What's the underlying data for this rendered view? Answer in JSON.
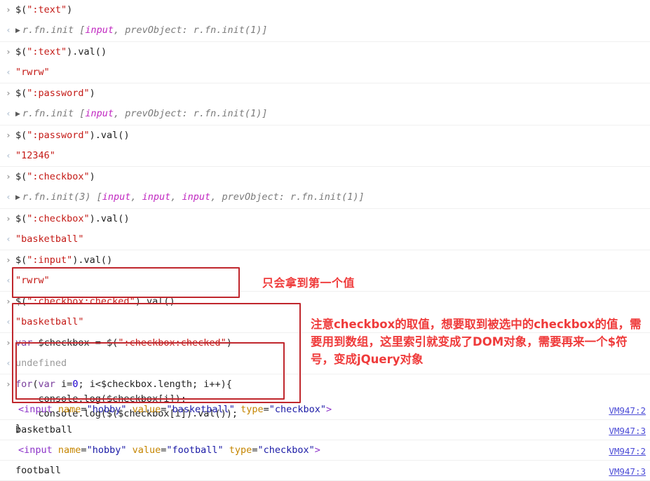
{
  "app": {
    "name": "chrome-devtools-console",
    "colors": {
      "string": "#c41a16",
      "keyword": "#7a3e9d",
      "number": "#1c00cf",
      "object": "#7a7a7a",
      "property": "#c026c0",
      "undefined": "#9a9a9a",
      "annotation_red": "#ef3b3b",
      "box_red": "#c0272d",
      "link_blue": "#4a4ad6",
      "divider": "#f0f0f0",
      "background": "#ffffff"
    },
    "gutter": {
      "input_glyph": "›",
      "output_glyph": "‹",
      "expand_glyph": "▶"
    }
  },
  "console_rows": [
    {
      "kind": "input",
      "gutter": "›",
      "segments": [
        {
          "text": "$(",
          "cls": "tok-plain"
        },
        {
          "text": "\":text\"",
          "cls": "tok-str"
        },
        {
          "text": ")",
          "cls": "tok-plain"
        }
      ]
    },
    {
      "kind": "output",
      "gutter": "‹",
      "expandable": true,
      "segments": [
        {
          "text": "r.fn.init ",
          "cls": "tok-obj"
        },
        {
          "text": "[",
          "cls": "tok-obj"
        },
        {
          "text": "input",
          "cls": "tok-prop"
        },
        {
          "text": ", ",
          "cls": "tok-obj"
        },
        {
          "text": "prevObject",
          "cls": "tok-obj"
        },
        {
          "text": ": r.fn.init(1)]",
          "cls": "tok-obj"
        }
      ]
    },
    {
      "kind": "input",
      "gutter": "›",
      "segments": [
        {
          "text": "$(",
          "cls": "tok-plain"
        },
        {
          "text": "\":text\"",
          "cls": "tok-str"
        },
        {
          "text": ").val()",
          "cls": "tok-plain"
        }
      ]
    },
    {
      "kind": "output",
      "gutter": "‹",
      "segments": [
        {
          "text": "\"rwrw\"",
          "cls": "tok-res"
        }
      ]
    },
    {
      "kind": "input",
      "gutter": "›",
      "segments": [
        {
          "text": "$(",
          "cls": "tok-plain"
        },
        {
          "text": "\":password\"",
          "cls": "tok-str"
        },
        {
          "text": ")",
          "cls": "tok-plain"
        }
      ]
    },
    {
      "kind": "output",
      "gutter": "‹",
      "expandable": true,
      "segments": [
        {
          "text": "r.fn.init ",
          "cls": "tok-obj"
        },
        {
          "text": "[",
          "cls": "tok-obj"
        },
        {
          "text": "input",
          "cls": "tok-prop"
        },
        {
          "text": ", ",
          "cls": "tok-obj"
        },
        {
          "text": "prevObject",
          "cls": "tok-obj"
        },
        {
          "text": ": r.fn.init(1)]",
          "cls": "tok-obj"
        }
      ]
    },
    {
      "kind": "input",
      "gutter": "›",
      "segments": [
        {
          "text": "$(",
          "cls": "tok-plain"
        },
        {
          "text": "\":password\"",
          "cls": "tok-str"
        },
        {
          "text": ").val()",
          "cls": "tok-plain"
        }
      ]
    },
    {
      "kind": "output",
      "gutter": "‹",
      "segments": [
        {
          "text": "\"12346\"",
          "cls": "tok-res"
        }
      ]
    },
    {
      "kind": "input",
      "gutter": "›",
      "segments": [
        {
          "text": "$(",
          "cls": "tok-plain"
        },
        {
          "text": "\":checkbox\"",
          "cls": "tok-str"
        },
        {
          "text": ")",
          "cls": "tok-plain"
        }
      ]
    },
    {
      "kind": "output",
      "gutter": "‹",
      "expandable": true,
      "segments": [
        {
          "text": "r.fn.init(3) ",
          "cls": "tok-obj"
        },
        {
          "text": "[",
          "cls": "tok-obj"
        },
        {
          "text": "input",
          "cls": "tok-prop"
        },
        {
          "text": ", ",
          "cls": "tok-obj"
        },
        {
          "text": "input",
          "cls": "tok-prop"
        },
        {
          "text": ", ",
          "cls": "tok-obj"
        },
        {
          "text": "input",
          "cls": "tok-prop"
        },
        {
          "text": ", ",
          "cls": "tok-obj"
        },
        {
          "text": "prevObject",
          "cls": "tok-obj"
        },
        {
          "text": ": r.fn.init(1)]",
          "cls": "tok-obj"
        }
      ]
    },
    {
      "kind": "input",
      "gutter": "›",
      "segments": [
        {
          "text": "$(",
          "cls": "tok-plain"
        },
        {
          "text": "\":checkbox\"",
          "cls": "tok-str"
        },
        {
          "text": ").val()",
          "cls": "tok-plain"
        }
      ]
    },
    {
      "kind": "output",
      "gutter": "‹",
      "segments": [
        {
          "text": "\"basketball\"",
          "cls": "tok-res"
        }
      ]
    },
    {
      "kind": "input",
      "gutter": "›",
      "segments": [
        {
          "text": "$(",
          "cls": "tok-plain"
        },
        {
          "text": "\":input\"",
          "cls": "tok-str"
        },
        {
          "text": ").val()",
          "cls": "tok-plain"
        }
      ]
    },
    {
      "kind": "output",
      "gutter": "‹",
      "segments": [
        {
          "text": "\"rwrw\"",
          "cls": "tok-res"
        }
      ]
    },
    {
      "kind": "input",
      "gutter": "›",
      "segments": [
        {
          "text": "$(",
          "cls": "tok-plain"
        },
        {
          "text": "\":checkbox:checked\"",
          "cls": "tok-str"
        },
        {
          "text": ").val()",
          "cls": "tok-plain"
        }
      ]
    },
    {
      "kind": "output",
      "gutter": "‹",
      "segments": [
        {
          "text": "\"basketball\"",
          "cls": "tok-res"
        }
      ]
    },
    {
      "kind": "input",
      "gutter": "›",
      "segments": [
        {
          "text": "var",
          "cls": "tok-kw"
        },
        {
          "text": " $checkbox = $(",
          "cls": "tok-plain"
        },
        {
          "text": "\":checkbox:checked\"",
          "cls": "tok-str"
        },
        {
          "text": ")",
          "cls": "tok-plain"
        }
      ]
    },
    {
      "kind": "output",
      "gutter": "‹",
      "segments": [
        {
          "text": "undefined",
          "cls": "tok-undef"
        }
      ]
    },
    {
      "kind": "input-multiline",
      "gutter": "›",
      "lines": [
        [
          {
            "text": "for",
            "cls": "tok-kw"
          },
          {
            "text": "(",
            "cls": "tok-plain"
          },
          {
            "text": "var",
            "cls": "tok-kw"
          },
          {
            "text": " i=",
            "cls": "tok-plain"
          },
          {
            "text": "0",
            "cls": "tok-num"
          },
          {
            "text": "; i<$checkbox.length; i++){",
            "cls": "tok-plain"
          }
        ],
        [
          {
            "text": "    console.log($checkbox[i]);",
            "cls": "tok-plain"
          }
        ],
        [
          {
            "text": "    console.log($($checkbox[i]).val());",
            "cls": "tok-plain"
          }
        ],
        [
          {
            "text": "}",
            "cls": "tok-plain"
          }
        ]
      ]
    }
  ],
  "log_rows": [
    {
      "type": "html-node",
      "link": "VM947:2",
      "segments": [
        {
          "text": "<input",
          "cls": "tag-br"
        },
        {
          "text": " name",
          "cls": "attr-n"
        },
        {
          "text": "=",
          "cls": "plainlog"
        },
        {
          "text": "\"hobby\"",
          "cls": "attr-v"
        },
        {
          "text": " value",
          "cls": "attr-n"
        },
        {
          "text": "=",
          "cls": "plainlog"
        },
        {
          "text": "\"basketball\"",
          "cls": "attr-v"
        },
        {
          "text": " type",
          "cls": "attr-n"
        },
        {
          "text": "=",
          "cls": "plainlog"
        },
        {
          "text": "\"checkbox\"",
          "cls": "attr-v"
        },
        {
          "text": ">",
          "cls": "tag-br"
        }
      ]
    },
    {
      "type": "plain",
      "link": "VM947:3",
      "segments": [
        {
          "text": "basketball",
          "cls": "plainlog"
        }
      ]
    },
    {
      "type": "html-node",
      "link": "VM947:2",
      "segments": [
        {
          "text": "<input",
          "cls": "tag-br"
        },
        {
          "text": " name",
          "cls": "attr-n"
        },
        {
          "text": "=",
          "cls": "plainlog"
        },
        {
          "text": "\"hobby\"",
          "cls": "attr-v"
        },
        {
          "text": " value",
          "cls": "attr-n"
        },
        {
          "text": "=",
          "cls": "plainlog"
        },
        {
          "text": "\"football\"",
          "cls": "attr-v"
        },
        {
          "text": " type",
          "cls": "attr-n"
        },
        {
          "text": "=",
          "cls": "plainlog"
        },
        {
          "text": "\"checkbox\"",
          "cls": "attr-v"
        },
        {
          "text": ">",
          "cls": "tag-br"
        }
      ]
    },
    {
      "type": "plain",
      "link": "VM947:3",
      "segments": [
        {
          "text": "football",
          "cls": "plainlog"
        }
      ]
    }
  ],
  "annotations": {
    "note_1": "只会拿到第一个值",
    "note_2": "注意checkbox的取值，想要取到被选中的checkbox的值，需要用到数组，这里索引就变成了DOM对象，需要再来一个$符号，变成jQuery对象"
  }
}
